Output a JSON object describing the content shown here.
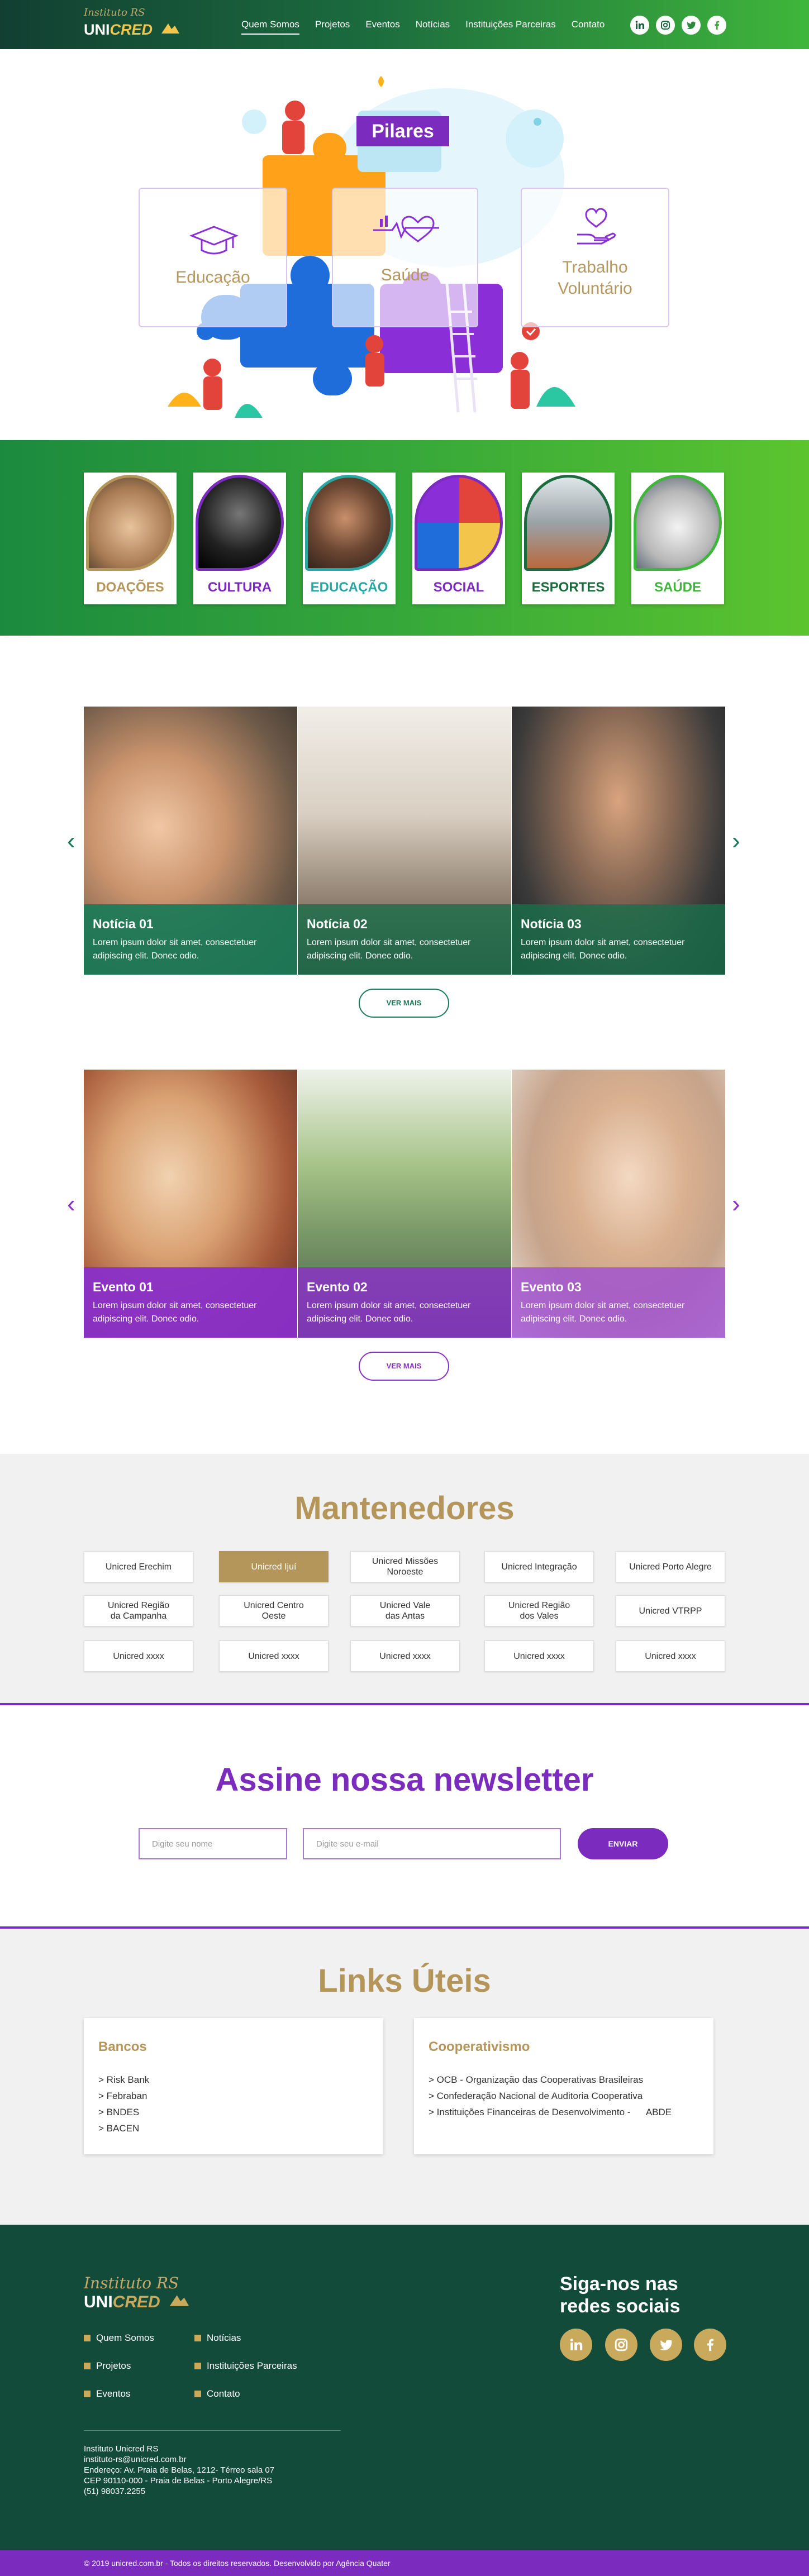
{
  "header": {
    "logo_institute": "Instituto RS",
    "logo_uni": "UNI",
    "logo_cred": "CRED",
    "nav": [
      "Quem Somos",
      "Projetos",
      "Eventos",
      "Notícias",
      "Instituições Parceiras",
      "Contato"
    ],
    "social_icons": [
      "linkedin-icon",
      "instagram-icon",
      "twitter-icon",
      "facebook-icon"
    ]
  },
  "hero": {
    "tag": "Pilares",
    "cards": [
      "Educação",
      "Saúde",
      "Trabalho Voluntário"
    ],
    "slides_count": 3,
    "active_slide": 1
  },
  "categories": [
    {
      "label": "DOAÇÕES",
      "color": "#b5965a"
    },
    {
      "label": "CULTURA",
      "color": "#7c2bbf"
    },
    {
      "label": "EDUCAÇÃO",
      "color": "#2aa6a2"
    },
    {
      "label": "SOCIAL",
      "color": "#7c2bbf"
    },
    {
      "label": "ESPORTES",
      "color": "#1b6b3e"
    },
    {
      "label": "SAÚDE",
      "color": "#3fb63b"
    }
  ],
  "news": {
    "items": [
      {
        "title": "Notícia 01",
        "text": "Lorem ipsum dolor sit amet, consectetuer adipiscing elit. Donec odio."
      },
      {
        "title": "Notícia 02",
        "text": "Lorem ipsum dolor sit amet, consectetuer adipiscing elit. Donec odio."
      },
      {
        "title": "Notícia 03",
        "text": "Lorem ipsum dolor sit amet, consectetuer adipiscing elit. Donec odio."
      }
    ],
    "more": "VER MAIS",
    "accent": "#1b7a57"
  },
  "events": {
    "items": [
      {
        "title": "Evento 01",
        "text": "Lorem ipsum dolor sit amet, consectetuer adipiscing elit. Donec odio."
      },
      {
        "title": "Evento 02",
        "text": "Lorem ipsum dolor sit amet, consectetuer adipiscing elit. Donec odio."
      },
      {
        "title": "Evento 03",
        "text": "Lorem ipsum dolor sit amet, consectetuer adipiscing elit. Donec odio."
      }
    ],
    "more": "VER MAIS",
    "accent": "#8a2fc9"
  },
  "mantenedores": {
    "title": "Mantenedores",
    "active_index": 1,
    "items": [
      "Unicred Erechim",
      "Unicred Ijuí",
      "Unicred Missões Noroeste",
      "Unicred Integração",
      "Unicred Porto Alegre",
      "Unicred Região da Campanha",
      "Unicred Centro Oeste",
      "Unicred Vale das Antas",
      "Unicred Região dos Vales",
      "Unicred VTRPP",
      "Unicred xxxx",
      "Unicred xxxx",
      "Unicred xxxx",
      "Unicred xxxx",
      "Unicred xxxx"
    ]
  },
  "newsletter": {
    "title": "Assine nossa newsletter",
    "name_placeholder": "Digite seu nome",
    "email_placeholder": "Digite seu e-mail",
    "button": "ENVIAR"
  },
  "links": {
    "title": "Links Úteis",
    "bancos": {
      "title": "Bancos",
      "items": [
        "> Risk Bank",
        "> Febraban",
        "> BNDES",
        "> BACEN"
      ]
    },
    "cooperativismo": {
      "title": "Cooperativismo",
      "items": [
        "> OCB - Organização das Cooperativas Brasileiras",
        "> Confederação Nacional de Auditoria Cooperativa",
        "> Instituições Financeiras de Desenvolvimento -      ABDE"
      ]
    }
  },
  "footer": {
    "logo_institute": "Instituto RS",
    "logo_uni": "UNI",
    "logo_cred": "CRED",
    "nav": [
      "Quem Somos",
      "Notícias",
      "Projetos",
      "Instituições Parceiras",
      "Eventos",
      "Contato"
    ],
    "address": [
      "Instituto Unicred RS",
      "instituto-rs@unicred.com.br",
      "Endereço: Av. Praia de Belas, 1212- Térreo sala 07",
      "CEP 90110-000 - Praia de Belas - Porto Alegre/RS",
      "(51) 98037.2255"
    ],
    "follow_title_1": "Siga-nos nas",
    "follow_title_2": "redes sociais",
    "social_icons": [
      "linkedin-icon",
      "instagram-icon",
      "twitter-icon",
      "facebook-icon"
    ],
    "copyright": "© 2019 unicred.com.br - Todos os direitos reservados. Desenvolvido por Agência Quater"
  }
}
